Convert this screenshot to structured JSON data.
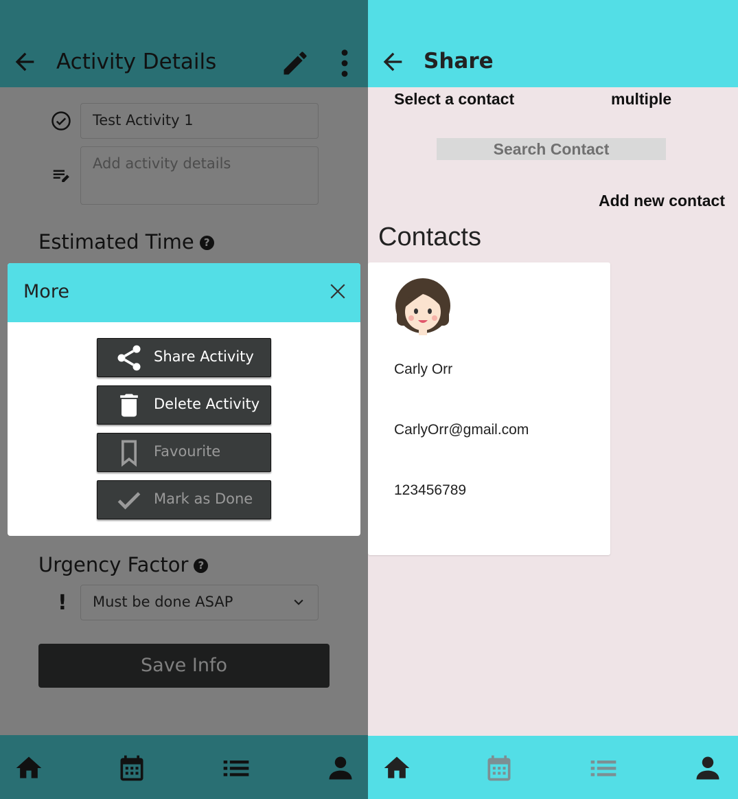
{
  "activity_screen": {
    "title": "Activity Details",
    "name_value": "Test Activity 1",
    "details_placeholder": "Add activity details",
    "estimated_time_label": "Estimated Time",
    "urgency_label": "Urgency Factor",
    "urgency_value": "Must be done ASAP",
    "save_label": "Save Info",
    "help_glyph": "?",
    "urgency_glyph": "!"
  },
  "more_modal": {
    "title": "More",
    "buttons": [
      {
        "label": "Share Activity",
        "icon": "share-icon",
        "enabled": true
      },
      {
        "label": "Delete Activity",
        "icon": "trash-icon",
        "enabled": true
      },
      {
        "label": "Favourite",
        "icon": "bookmark-icon",
        "enabled": false
      },
      {
        "label": "Mark as Done",
        "icon": "check-icon",
        "enabled": false
      }
    ]
  },
  "share_screen": {
    "title": "Share",
    "select_label": "Select a contact",
    "multiple_label": "multiple",
    "search_placeholder": "Search Contact",
    "add_contact_label": "Add new contact",
    "contacts_heading": "Contacts",
    "contacts": [
      {
        "name": "Carly Orr",
        "email": "CarlyOrr@gmail.com",
        "phone": "123456789"
      }
    ]
  },
  "bottom_nav": [
    "home-icon",
    "calendar-icon",
    "list-icon",
    "person-icon"
  ],
  "colors": {
    "accent": "#53dee6",
    "button_dark": "#393c3c",
    "right_background": "#efe4e7"
  }
}
